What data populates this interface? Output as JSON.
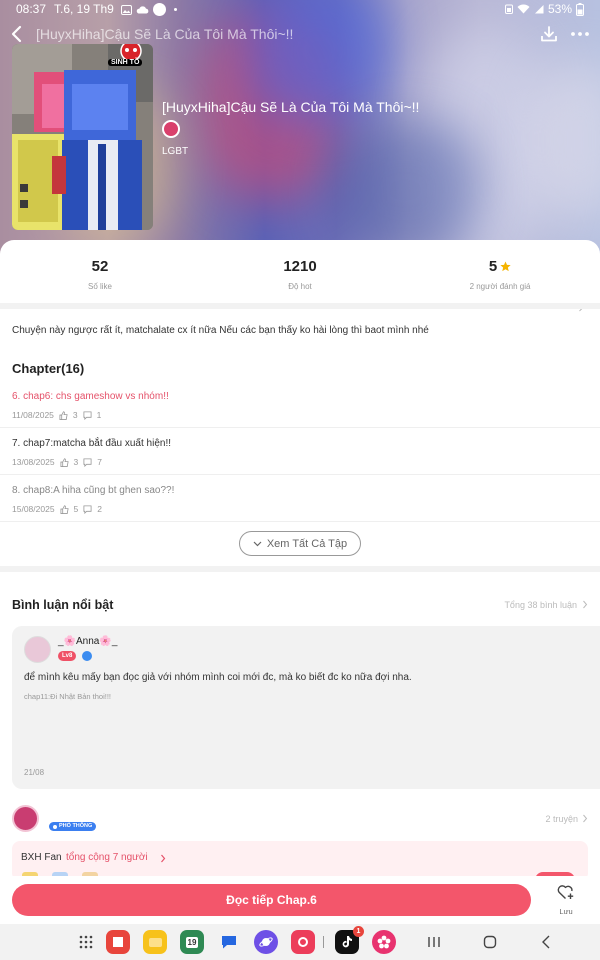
{
  "status_bar": {
    "time": "08:37",
    "date": "T.6, 19 Th9",
    "battery": "53%"
  },
  "header": {
    "title": "[HuyxHiha]Cậu Sẽ Là Của Tôi Mà Thôi~!!",
    "cover_badge": "SINH TỒ"
  },
  "story": {
    "title": "[HuyxHiha]Cậu Sẽ Là Của Tôi Mà Thôi~!!",
    "genre": "LGBT"
  },
  "stats": [
    {
      "value": "52",
      "label": "Số like"
    },
    {
      "value": "1210",
      "label": "Độ hot"
    },
    {
      "value": "5",
      "label": "2 người đánh giá"
    }
  ],
  "description": "Chuyện này ngược rất ít, matchalate cx ít nữa Nếu các bạn thấy ko hài lòng thì baot mình nhé",
  "chapters_heading": "Chapter(16)",
  "chapters": [
    {
      "title": "6. chap6: chs gameshow vs nhóm!!",
      "date": "11/08/2025",
      "likes": "3",
      "comments": "1"
    },
    {
      "title": "7. chap7:matcha bắt đầu xuất hiện!!",
      "date": "13/08/2025",
      "likes": "3",
      "comments": "7"
    },
    {
      "title": "8. chap8:A hiha cũng bt ghen sao??!",
      "date": "15/08/2025",
      "likes": "5",
      "comments": "2"
    }
  ],
  "see_all_label": "Xem Tất Cả Tập",
  "comments": {
    "heading": "Bình luận nổi bật",
    "total": "Tổng 38 bình luận",
    "featured": {
      "username": "_🌸Anna🌸_",
      "level": "Lv8",
      "text": "để mình kêu mấy bạn đọc giả với nhóm mình coi mới đc, mà ko biết đc ko nữa đợi nha.",
      "chapter": "chap11:Đi Nhật Bản thoi!!!",
      "date": "21/08"
    }
  },
  "fan_section": {
    "badge": "PHỔ THÔNG",
    "count": "2 truyện",
    "ranking_label": "BXH Fan",
    "ranking_total": "tổng cộng 7 người"
  },
  "action_bar": {
    "read_label": "Đọc tiếp Chap.6",
    "save_label": "Lưu"
  },
  "nav_bar": {
    "calendar_day": "19",
    "tiktok_badge": "1"
  },
  "colors": {
    "accent": "#f3566b",
    "accent_text": "#e5526a",
    "star": "#f5b400"
  }
}
